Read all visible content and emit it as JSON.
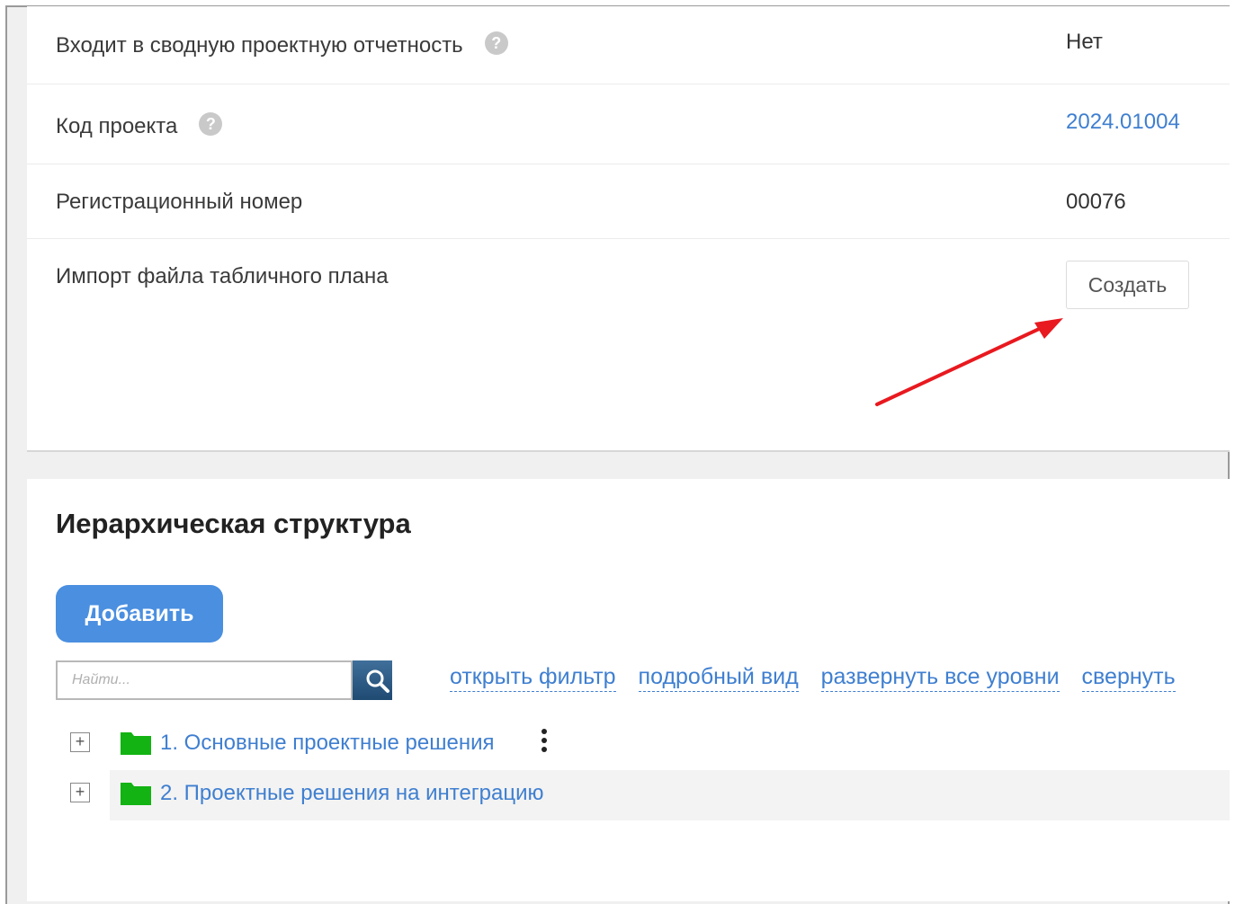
{
  "properties": [
    {
      "label": "Входит в сводную проектную отчетность",
      "has_help": true,
      "value": "Нет"
    },
    {
      "label": "Код проекта",
      "has_help": true,
      "value": "2024.01004"
    },
    {
      "label": "Регистрационный номер",
      "has_help": false,
      "value": "00076"
    },
    {
      "label": "Импорт файла табличного плана",
      "has_help": false,
      "value": ""
    }
  ],
  "import": {
    "create_label": "Создать"
  },
  "help_glyph": "?",
  "colors": {
    "link": "#3f7fd0",
    "primary_button": "#4a8fe0",
    "folder": "#12b312",
    "arrow": "#e8191f"
  },
  "hierarchy": {
    "title": "Иерархическая структура",
    "add_label": "Добавить",
    "search_placeholder": "Найти...",
    "links": [
      "открыть фильтр",
      "подробный вид",
      "развернуть все уровни",
      "свернуть"
    ],
    "items": [
      {
        "label": "1. Основные проектные решения",
        "expand": "+",
        "icon": "folder-icon"
      },
      {
        "label": "2. Проектные решения на интеграцию",
        "expand": "+",
        "icon": "folder-icon"
      }
    ]
  }
}
